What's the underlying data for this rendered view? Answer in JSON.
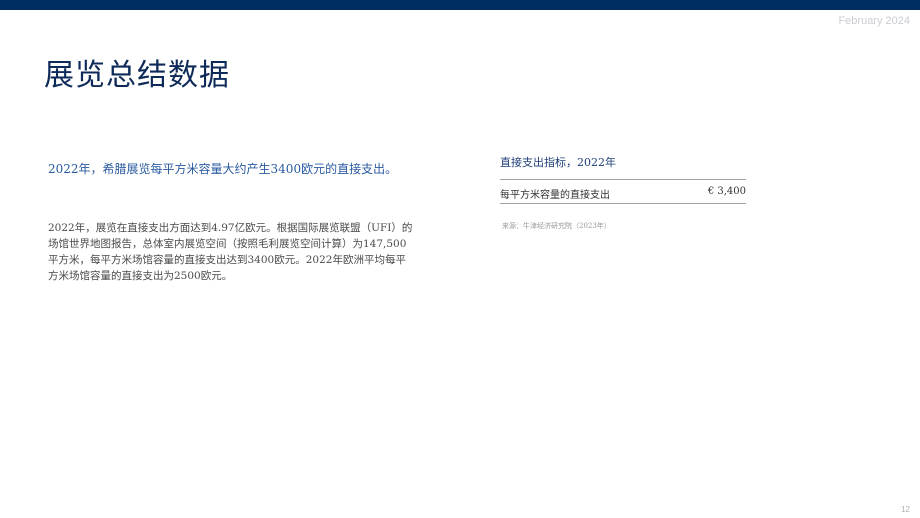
{
  "header": {
    "date": "February 2024"
  },
  "title": "展览总结数据",
  "lead": "2022年，希腊展览每平方米容量大约产生3400欧元的直接支出。",
  "body": {
    "lines": [
      "2022年，展览在直接支出方面达到4.97亿欧元。根据国际展览联盟（UFI）的",
      "场馆世界地图报告，总体室内展览空间（按照毛利展览空间计算）为147,500",
      "平方米，每平方米场馆容量的直接支出达到3400欧元。2022年欧洲平均每平",
      "方米场馆容量的直接支出为2500欧元。"
    ]
  },
  "table": {
    "title": "直接支出指标，2022年",
    "rows": [
      {
        "label": "每平方米容量的直接支出",
        "value": "€ 3,400"
      }
    ],
    "source": "来源：牛津经济研究院（2023年）"
  },
  "footer": {
    "page": "12"
  }
}
